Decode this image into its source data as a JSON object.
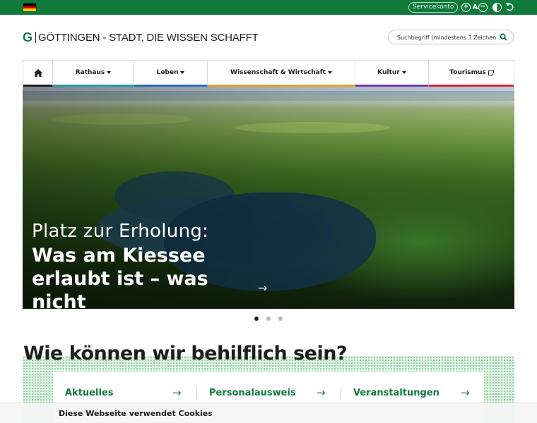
{
  "topbar": {
    "language": "Deutsch",
    "flag_colors": [
      "#000000",
      "#dd0000",
      "#ffce00"
    ],
    "servicekonto_label": "Servicekonto",
    "font_size_label": "A"
  },
  "header": {
    "logo_mark": "G",
    "logo_text": "GÖTTINGEN - STADT, DIE WISSEN SCHAFFT",
    "search_placeholder": "Suchbegriff (mindestens 3 Zeichen)"
  },
  "nav": {
    "items": [
      {
        "label": "",
        "type": "home",
        "color": "#1d1d1b"
      },
      {
        "label": "Rathaus",
        "type": "dropdown",
        "color": "#2b9aa5"
      },
      {
        "label": "Leben",
        "type": "dropdown",
        "color": "#2f6db1"
      },
      {
        "label": "Wissenschaft & Wirtschaft",
        "type": "dropdown",
        "color": "#e1a22a"
      },
      {
        "label": "Kultur",
        "type": "dropdown",
        "color": "#7a3aa8"
      },
      {
        "label": "Tourismus",
        "type": "external",
        "color": "#d8283a"
      }
    ]
  },
  "hero": {
    "kicker": "Platz zur Erholung:",
    "title": "Was am Kiessee erlaubt ist – was nicht",
    "arrow": "→",
    "slides": 3,
    "active_slide": 1
  },
  "help": {
    "title": "Wie können wir behilflich sein?",
    "links": [
      {
        "label": "Aktuelles"
      },
      {
        "label": "Personalausweis"
      },
      {
        "label": "Veranstaltungen"
      }
    ],
    "arrow": "→"
  },
  "cookie": {
    "text": "Diese Webseite verwendet Cookies"
  },
  "colors": {
    "brand_green": "#0f7a3c"
  }
}
